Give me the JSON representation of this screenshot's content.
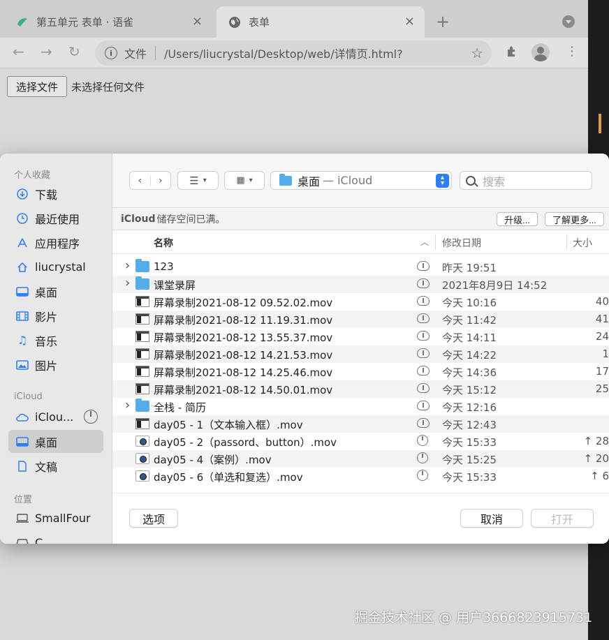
{
  "browser": {
    "tabs": [
      {
        "title": "第五单元 表单 · 语雀",
        "icon": "yuque-icon",
        "close": "×"
      },
      {
        "title": "表单",
        "icon": "globe-icon",
        "close": "×"
      }
    ],
    "new_tab": "+",
    "url_scheme": "文件",
    "url": "/Users/liucrystal/Desktop/web/详情页.html?"
  },
  "page": {
    "choose_file_label": "选择文件",
    "no_file_label": "未选择任何文件"
  },
  "dialog": {
    "sidebar": {
      "favorites_header": "个人收藏",
      "favorites": [
        {
          "label": "下载",
          "icon": "download-icon"
        },
        {
          "label": "最近使用",
          "icon": "clock-icon"
        },
        {
          "label": "应用程序",
          "icon": "apps-icon"
        },
        {
          "label": "liucrystal",
          "icon": "home-icon"
        },
        {
          "label": "桌面",
          "icon": "desktop-icon"
        },
        {
          "label": "影片",
          "icon": "film-icon"
        },
        {
          "label": "音乐",
          "icon": "music-icon"
        },
        {
          "label": "图片",
          "icon": "photo-icon"
        }
      ],
      "icloud_header": "iCloud",
      "icloud": [
        {
          "label": "iClou...",
          "icon": "icloud-icon"
        },
        {
          "label": "桌面",
          "icon": "desktop-icon",
          "selected": true
        },
        {
          "label": "文稿",
          "icon": "document-icon"
        }
      ],
      "locations_header": "位置",
      "locations": [
        {
          "label": "SmallFour",
          "icon": "laptop-icon"
        },
        {
          "label": "C...",
          "icon": "drive-icon"
        }
      ]
    },
    "location": {
      "name": "桌面",
      "sub": "— iCloud"
    },
    "search_placeholder": "搜索",
    "banner": {
      "bold": "iCloud",
      "text": "储存空间已满。",
      "upgrade": "升级...",
      "learn_more": "了解更多..."
    },
    "columns": {
      "name": "名称",
      "date": "修改日期",
      "size": "大小"
    },
    "files": [
      {
        "name": "123",
        "type": "folder",
        "status": "cloud",
        "date": "昨天 19:51",
        "size": ""
      },
      {
        "name": "课堂录屏",
        "type": "folder",
        "status": "cloud",
        "date": "2021年8月9日 14:52",
        "size": ""
      },
      {
        "name": "屏幕录制2021-08-12 09.52.02.mov",
        "type": "mov",
        "status": "cloud",
        "date": "今天 10:16",
        "size": "40"
      },
      {
        "name": "屏幕录制2021-08-12 11.19.31.mov",
        "type": "mov",
        "status": "cloud",
        "date": "今天 11:42",
        "size": "41"
      },
      {
        "name": "屏幕录制2021-08-12 13.55.37.mov",
        "type": "mov",
        "status": "cloud",
        "date": "今天 14:11",
        "size": "24"
      },
      {
        "name": "屏幕录制2021-08-12 14.21.53.mov",
        "type": "mov",
        "status": "cloud",
        "date": "今天 14:22",
        "size": "1"
      },
      {
        "name": "屏幕录制2021-08-12 14.25.46.mov",
        "type": "mov",
        "status": "cloud",
        "date": "今天 14:36",
        "size": "17"
      },
      {
        "name": "屏幕录制2021-08-12 14.50.01.mov",
        "type": "mov",
        "status": "cloud",
        "date": "今天 15:12",
        "size": "25"
      },
      {
        "name": "全栈 - 简历",
        "type": "folder",
        "status": "cloud",
        "date": "今天 12:16",
        "size": ""
      },
      {
        "name": "day05 - 1（文本输入框）.mov",
        "type": "mov",
        "status": "cloud",
        "date": "今天 12:43",
        "size": ""
      },
      {
        "name": "day05 - 2（passord、button）.mov",
        "type": "qt",
        "status": "uploading",
        "date": "今天 15:33",
        "size": "↑ 28"
      },
      {
        "name": "day05 - 4（案例）.mov",
        "type": "qt",
        "status": "uploading",
        "date": "今天 15:25",
        "size": "↑ 20"
      },
      {
        "name": "day05 - 6（单选和复选）.mov",
        "type": "qt",
        "status": "uploading",
        "date": "今天 15:33",
        "size": "↑ 6"
      }
    ],
    "buttons": {
      "options": "选项",
      "cancel": "取消",
      "open": "打开"
    }
  },
  "watermark": "掘金技术社区 @ 用户3666823915731",
  "colors": {
    "accent": "#2d7ff9",
    "folder": "#55aeea",
    "orange_marker": "#e19a45"
  }
}
